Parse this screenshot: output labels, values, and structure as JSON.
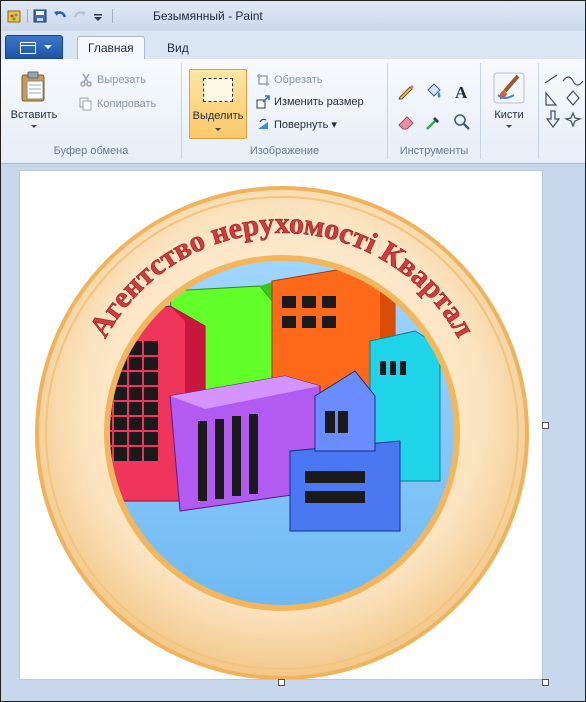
{
  "window": {
    "title": "Безымянный - Paint"
  },
  "tabs": [
    {
      "label": "Главная"
    },
    {
      "label": "Вид"
    }
  ],
  "ribbon": {
    "clipboard": {
      "paste_label": "Вставить",
      "cut_label": "Вырезать",
      "copy_label": "Копировать",
      "group_label": "Буфер обмена"
    },
    "image": {
      "select_label": "Выделить",
      "crop_label": "Обрезать",
      "resize_label": "Изменить размер",
      "rotate_label": "Повернуть ▾",
      "group_label": "Изображение"
    },
    "tools": {
      "group_label": "Инструменты"
    },
    "brushes": {
      "label": "Кисти"
    }
  },
  "logo": {
    "arc_text": "Агентство нерухомості Квартал"
  },
  "colors": {
    "accent_file": "#1e54a8",
    "ring": "#f0c58a",
    "logo_text": "#d33a3a"
  }
}
